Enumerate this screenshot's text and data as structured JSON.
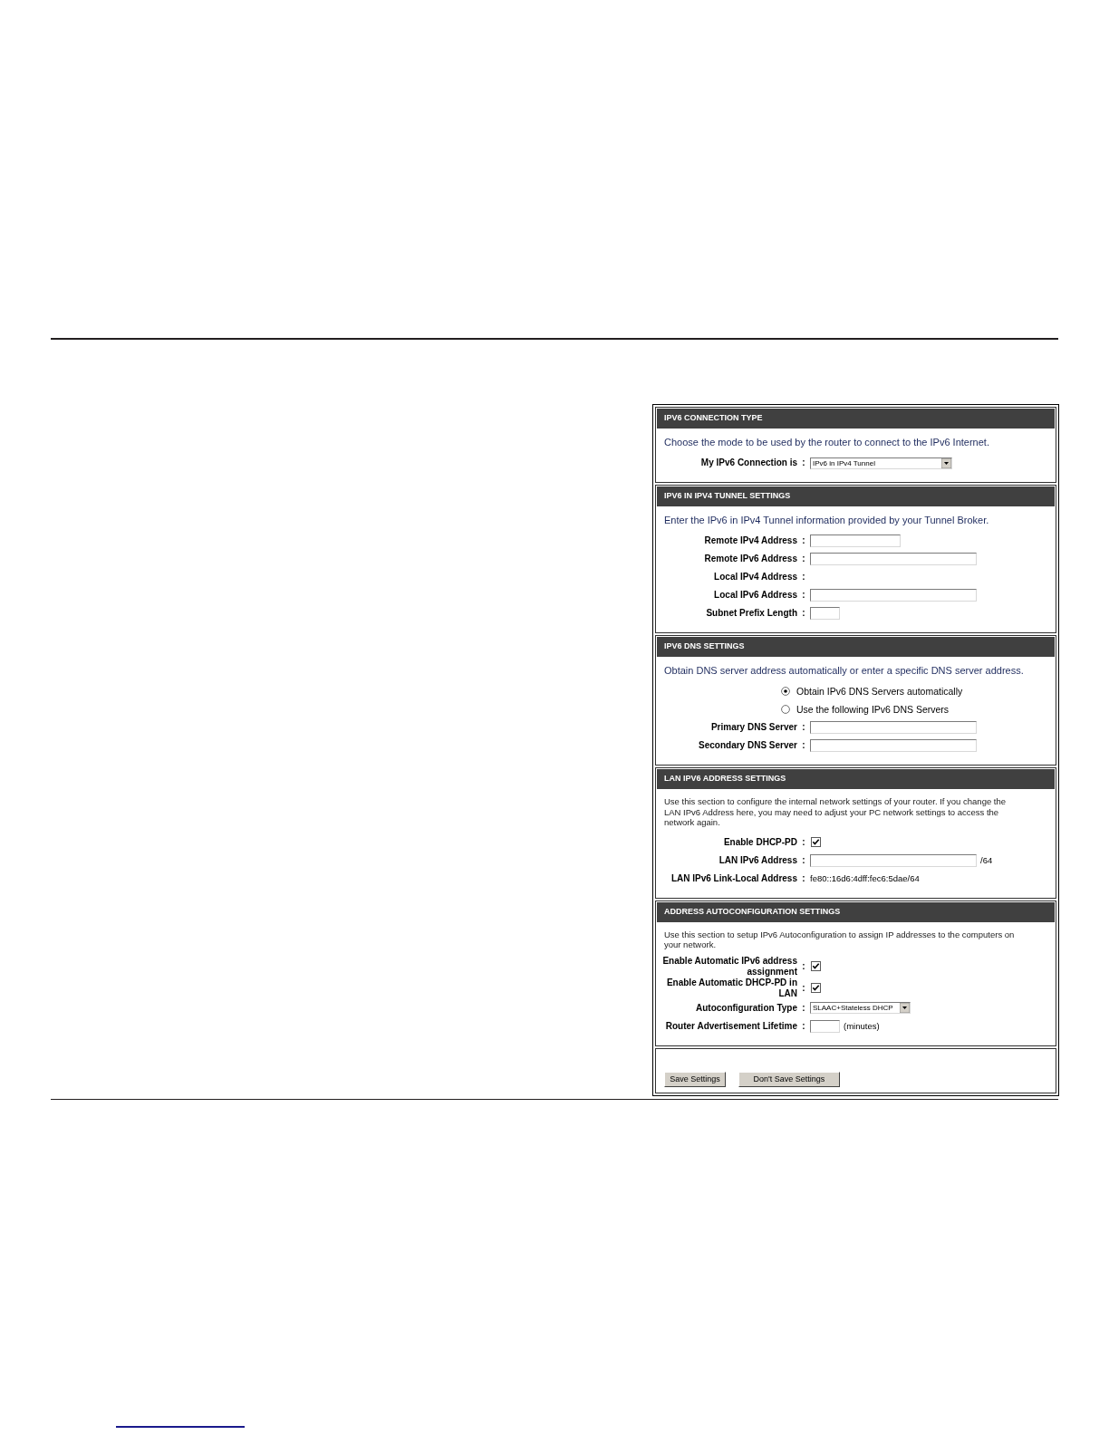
{
  "sections": [
    {
      "title": "IPV6 CONNECTION TYPE",
      "description": {
        "kind": "intro",
        "text": "Choose the mode to be used by the router to connect to the IPv6 Internet."
      },
      "fields": [
        {
          "kind": "select",
          "label": "My IPv6 Connection is",
          "colon": ":",
          "value": "IPv6 in IPv4 Tunnel"
        }
      ]
    },
    {
      "title": "IPV6 IN IPV4 TUNNEL SETTINGS",
      "description": {
        "kind": "intro",
        "text": "Enter the IPv6 in IPv4 Tunnel information provided by your Tunnel Broker."
      },
      "fields": [
        {
          "kind": "ipv4-input",
          "label": "Remote IPv4 Address",
          "colon": ":"
        },
        {
          "kind": "ipv6-input",
          "label": "Remote IPv6 Address",
          "colon": ":"
        },
        {
          "kind": "static",
          "label": "Local IPv4 Address",
          "colon": ":"
        },
        {
          "kind": "ipv6-input",
          "label": "Local IPv6 Address",
          "colon": ":"
        },
        {
          "kind": "number-input",
          "label": "Subnet Prefix Length",
          "colon": ":"
        }
      ]
    },
    {
      "title": "IPV6 DNS SETTINGS",
      "description": {
        "kind": "intro",
        "text": "Obtain DNS server address automatically or enter a specific DNS server address."
      },
      "fields": [
        {
          "kind": "radio",
          "label": "Obtain IPv6 DNS Servers automatically",
          "selected": true
        },
        {
          "kind": "radio",
          "label": "Use the following IPv6 DNS Servers",
          "selected": false
        },
        {
          "kind": "ipv6-input",
          "label": "Primary DNS Server",
          "colon": ":"
        },
        {
          "kind": "ipv6-input",
          "label": "Secondary DNS Server",
          "colon": ":"
        }
      ]
    },
    {
      "title": "LAN IPV6 ADDRESS SETTINGS",
      "description": {
        "kind": "help",
        "text": "Use this section to configure the internal network settings of your router. If you change the LAN IPv6 Address here, you may need to adjust your PC network settings to access the network again."
      },
      "fields": [
        {
          "kind": "checkbox",
          "label": "Enable DHCP-PD",
          "colon": ":",
          "checked": true
        },
        {
          "kind": "ipv6-input",
          "label": "LAN IPv6 Address",
          "colon": ":",
          "suffix": "/64"
        },
        {
          "kind": "text-value",
          "label": "LAN IPv6 Link-Local Address",
          "colon": ":",
          "value": "fe80::16d6:4dff:fec6:5dae/64"
        }
      ]
    },
    {
      "title": "ADDRESS AUTOCONFIGURATION SETTINGS",
      "description": {
        "kind": "help",
        "text": "Use this section to setup IPv6 Autoconfiguration to assign IP addresses to the computers on your network."
      },
      "fields": [
        {
          "kind": "checkbox",
          "label": "Enable Automatic IPv6 address assignment",
          "colon": ":",
          "checked": true
        },
        {
          "kind": "checkbox",
          "label": "Enable Automatic DHCP-PD in LAN",
          "colon": ":",
          "checked": true
        },
        {
          "kind": "select",
          "label": "Autoconfiguration Type",
          "colon": ":",
          "value": "SLAAC+Stateless DHCP"
        },
        {
          "kind": "number-input",
          "label": "Router Advertisement Lifetime",
          "colon": ":",
          "suffix": "(minutes)"
        }
      ]
    }
  ],
  "buttons": [
    {
      "label": "Save Settings"
    },
    {
      "label": "Don't Save Settings"
    }
  ]
}
